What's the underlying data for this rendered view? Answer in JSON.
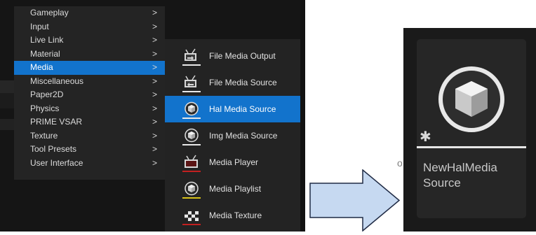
{
  "categories_menu": {
    "items": [
      {
        "label": "Gameplay",
        "chevron": ">"
      },
      {
        "label": "Input",
        "chevron": ">"
      },
      {
        "label": "Live Link",
        "chevron": ">"
      },
      {
        "label": "Material",
        "chevron": ">"
      },
      {
        "label": "Media",
        "chevron": ">",
        "active": true
      },
      {
        "label": "Miscellaneous",
        "chevron": ">"
      },
      {
        "label": "Paper2D",
        "chevron": ">"
      },
      {
        "label": "Physics",
        "chevron": ">"
      },
      {
        "label": "PRIME VSAR",
        "chevron": ">"
      },
      {
        "label": "Texture",
        "chevron": ">"
      },
      {
        "label": "Tool Presets",
        "chevron": ">"
      },
      {
        "label": "User Interface",
        "chevron": ">"
      }
    ]
  },
  "media_submenu": {
    "items": [
      {
        "label": "File Media Output",
        "icon": "file-media-output-icon",
        "underline": "#e8e8e8"
      },
      {
        "label": "File Media Source",
        "icon": "file-media-source-icon",
        "underline": "#e8e8e8"
      },
      {
        "label": "Hal Media Source",
        "icon": "hal-media-source-icon",
        "underline": "#e8e8e8",
        "active": true
      },
      {
        "label": "Img Media Source",
        "icon": "img-media-source-icon",
        "underline": "#e8e8e8"
      },
      {
        "label": "Media Player",
        "icon": "media-player-icon",
        "underline": "#c22020"
      },
      {
        "label": "Media Playlist",
        "icon": "media-playlist-icon",
        "underline": "#d8c21a"
      },
      {
        "label": "Media Texture",
        "icon": "media-texture-icon",
        "underline": "#c22020"
      }
    ]
  },
  "asset_tile": {
    "name": "NewHalMedia Source",
    "star": "✱",
    "icon": "media-source-sphere-icon"
  },
  "peek_text": "o",
  "colors": {
    "highlight": "#1273cc",
    "arrow_fill": "#c6d9f1",
    "arrow_stroke": "#1f2a44"
  }
}
